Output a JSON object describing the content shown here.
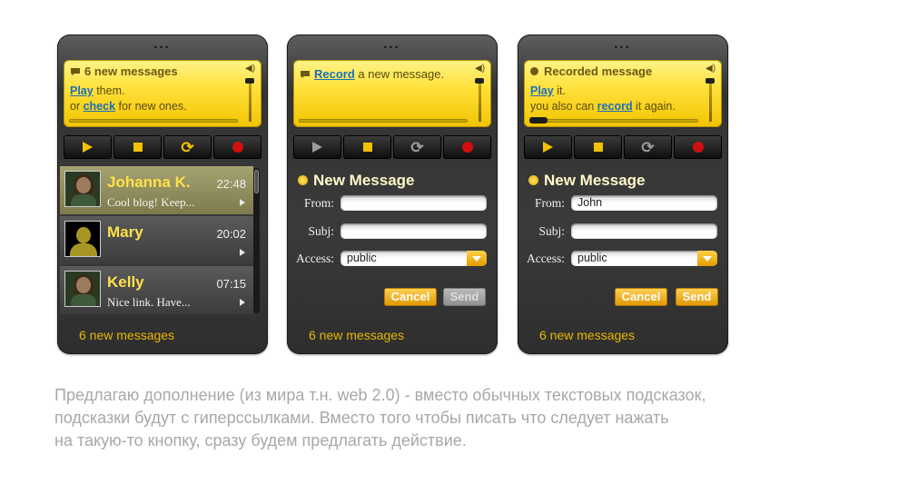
{
  "phone1": {
    "screen_title": "6 new messages",
    "line1_link": "Play",
    "line1_rest": " them.",
    "line2_pre": "or ",
    "line2_link": "check",
    "line2_rest": " for new ones.",
    "messages": [
      {
        "name": "Johanna K.",
        "time": "22:48",
        "text": "Cool blog! Keep..."
      },
      {
        "name": "Mary",
        "time": "20:02",
        "text": ""
      },
      {
        "name": "Kelly",
        "time": "07:15",
        "text": "Nice link. Have..."
      }
    ],
    "footer": "6 new messages"
  },
  "phone2": {
    "line1_link": "Record",
    "line1_rest": " a new message.",
    "form_title": "New Message",
    "from_label": "From:",
    "from_value": "",
    "subj_label": "Subj:",
    "subj_value": "",
    "access_label": "Access:",
    "access_value": "public",
    "cancel_label": "Cancel",
    "send_label": "Send",
    "footer": "6 new messages"
  },
  "phone3": {
    "screen_title": "Recorded message",
    "line1_link": "Play",
    "line1_rest": " it.",
    "line2_pre": "you also can ",
    "line2_link": "record",
    "line2_rest": " it again.",
    "form_title": "New Message",
    "from_label": "From:",
    "from_value": "John",
    "subj_label": "Subj:",
    "subj_value": "",
    "access_label": "Access:",
    "access_value": "public",
    "cancel_label": "Cancel",
    "send_label": "Send",
    "footer": "6 new messages"
  },
  "caption": {
    "line1": "Предлагаю дополнение (из мира т.н. web 2.0) - вместо обычных текстовых подсказок,",
    "line2": "подсказки будут с гиперссылками. Вместо того чтобы писать что следует нажать",
    "line3": "на такую-то кнопку, сразу будем предлагать действие."
  },
  "colors": {
    "accent": "#f2c200",
    "link": "#1b6fbf",
    "record": "#d01010"
  }
}
